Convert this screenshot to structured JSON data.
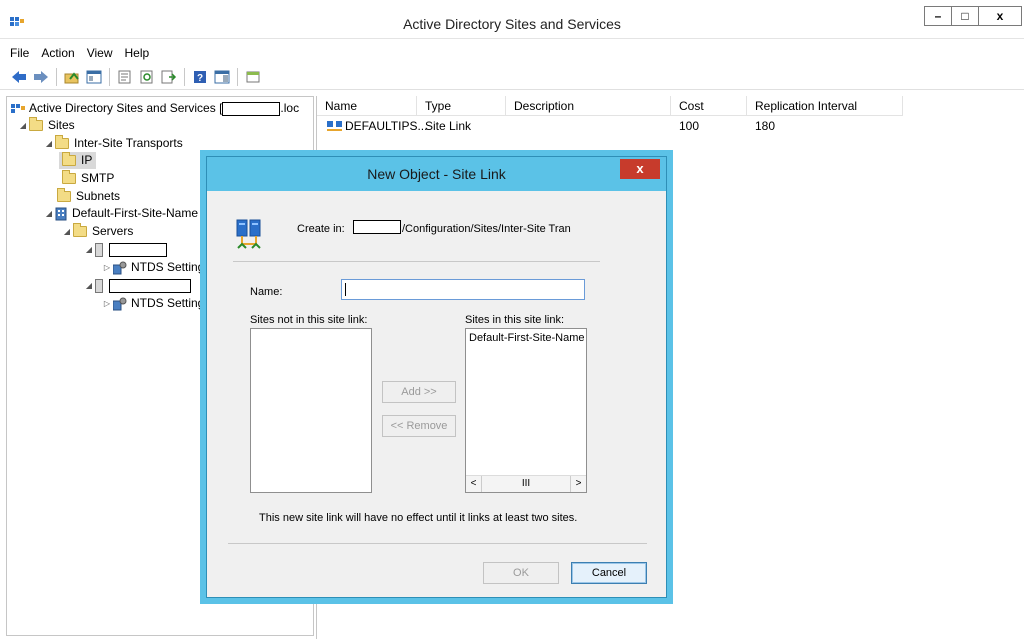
{
  "window": {
    "title": "Active Directory Sites and Services",
    "minimize": "–",
    "maximize": "□",
    "close": "x"
  },
  "menu": [
    "File",
    "Action",
    "View",
    "Help"
  ],
  "toolbar": [
    "back-icon",
    "forward-icon",
    "up-folder-icon",
    "show-hide-tree-icon",
    "properties-icon",
    "refresh-icon",
    "export-list-icon",
    "help-icon",
    "show-hide-action-pane-icon",
    "new-window-icon"
  ],
  "tree": {
    "root": "Active Directory Sites and Services [",
    "root_suffix": ".loc",
    "sites": "Sites",
    "inter_site": "Inter-Site Transports",
    "ip": "IP",
    "smtp": "SMTP",
    "subnets": "Subnets",
    "default_site": "Default-First-Site-Name",
    "servers": "Servers",
    "ntds1": "NTDS Setting",
    "ntds2": "NTDS Setting"
  },
  "list": {
    "columns": [
      "Name",
      "Type",
      "Description",
      "Cost",
      "Replication Interval"
    ],
    "rows": [
      {
        "name": "DEFAULTIPS...",
        "type": "Site Link",
        "description": "",
        "cost": "100",
        "interval": "180"
      }
    ]
  },
  "dialog": {
    "title": "New Object - Site Link",
    "close": "x",
    "create_in_label": "Create in:",
    "create_in_path": "/Configuration/Sites/Inter-Site Tran",
    "name_label": "Name:",
    "name_value": "",
    "sites_not_label": "Sites not in this site link:",
    "sites_in_label": "Sites in this site link:",
    "sites_not": [],
    "sites_in": [
      "Default-First-Site-Name"
    ],
    "add_button": "Add >>",
    "remove_button": "<< Remove",
    "scroll_left": "<",
    "scroll_thumb": "III",
    "scroll_right": ">",
    "note": "This new site link will have no effect until it links at least two sites.",
    "ok_button": "OK",
    "cancel_button": "Cancel"
  }
}
